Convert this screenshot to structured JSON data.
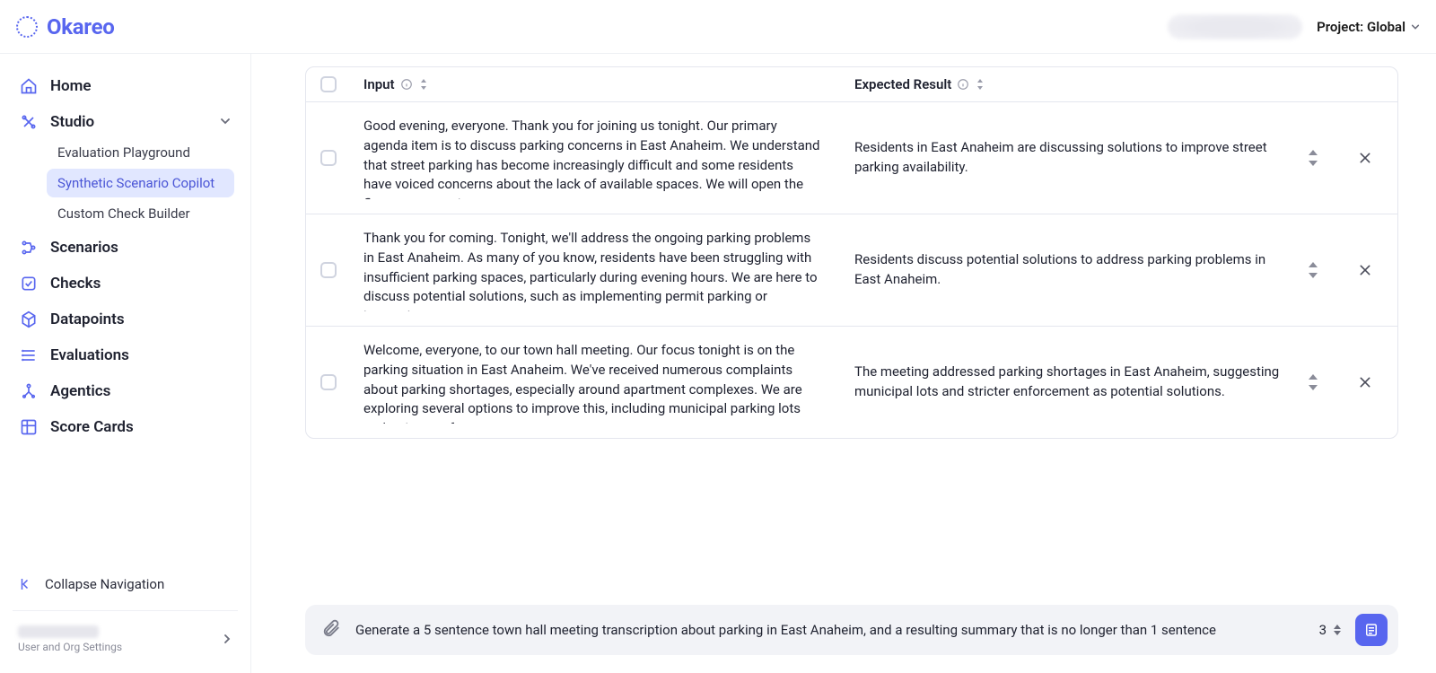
{
  "brand": "Okareo",
  "header": {
    "project_label": "Project: Global"
  },
  "sidebar": {
    "home": "Home",
    "studio": "Studio",
    "studio_children": [
      {
        "label": "Evaluation Playground"
      },
      {
        "label": "Synthetic Scenario Copilot"
      },
      {
        "label": "Custom Check Builder"
      }
    ],
    "scenarios": "Scenarios",
    "checks": "Checks",
    "datapoints": "Datapoints",
    "evaluations": "Evaluations",
    "agentics": "Agentics",
    "scorecards": "Score Cards",
    "collapse": "Collapse Navigation",
    "user_settings": "User and Org Settings"
  },
  "table": {
    "columns": {
      "input": "Input",
      "expected": "Expected Result"
    },
    "rows": [
      {
        "input": "Good evening, everyone. Thank you for joining us tonight. Our primary agenda item is to discuss parking concerns in East Anaheim. We understand that street parking has become increasingly difficult and some residents have voiced concerns about the lack of available spaces. We will open the floor to suggestions",
        "expected": "Residents in East Anaheim are discussing solutions to improve street parking availability."
      },
      {
        "input": "Thank you for coming. Tonight, we'll address the ongoing parking problems in East Anaheim. As many of you know, residents have been struggling with insufficient parking spaces, particularly during evening hours. We are here to discuss potential solutions, such as implementing permit parking or increasing",
        "expected": "Residents discuss potential solutions to address parking problems in East Anaheim."
      },
      {
        "input": "Welcome, everyone, to our town hall meeting. Our focus tonight is on the parking situation in East Anaheim. We've received numerous complaints about parking shortages, especially around apartment complexes. We are exploring several options to improve this, including municipal parking lots and stricter enforcement",
        "expected": "The meeting addressed parking shortages in East Anaheim, suggesting municipal lots and stricter enforcement as potential solutions."
      }
    ]
  },
  "prompt": {
    "text": "Generate a 5 sentence town hall meeting transcription about parking in East Anaheim, and a resulting summary that is no longer than 1 sentence",
    "count": "3"
  }
}
